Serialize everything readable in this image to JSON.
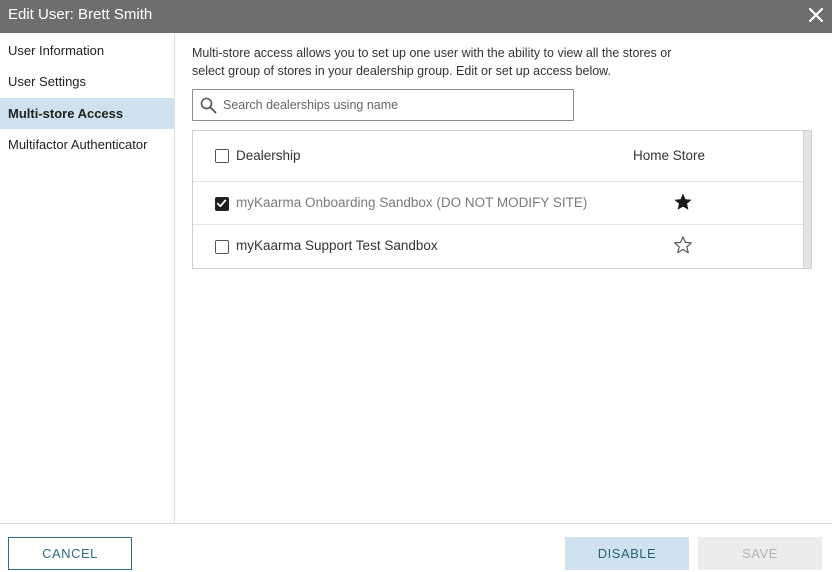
{
  "window": {
    "title": "Edit User: Brett Smith"
  },
  "sidebar": {
    "items": [
      {
        "label": "User Information",
        "active": false
      },
      {
        "label": "User Settings",
        "active": false
      },
      {
        "label": "Multi-store Access",
        "active": true
      },
      {
        "label": "Multifactor Authenticator",
        "active": false
      }
    ]
  },
  "main": {
    "description_line1": "Multi-store access allows you to set up one user with the ability to view all the stores or",
    "description_line2": "select group of stores in your dealership group. Edit or set up access below.",
    "search": {
      "placeholder": "Search dealerships using name",
      "value": "",
      "icon": "search-icon"
    },
    "table": {
      "columns": {
        "dealership": "Dealership",
        "home_store": "Home Store"
      },
      "select_all_checked": false,
      "rows": [
        {
          "name": "myKaarma Onboarding Sandbox (DO NOT MODIFY SITE)",
          "checked": true,
          "home_store": true
        },
        {
          "name": "myKaarma Support Test Sandbox",
          "checked": false,
          "home_store": false
        }
      ]
    }
  },
  "footer": {
    "cancel_label": "CANCEL",
    "disable_label": "DISABLE",
    "save_label": "SAVE"
  },
  "colors": {
    "titlebar": "#6e6e6e",
    "active_nav": "#cfe1ee",
    "accent": "#2c6f86"
  }
}
